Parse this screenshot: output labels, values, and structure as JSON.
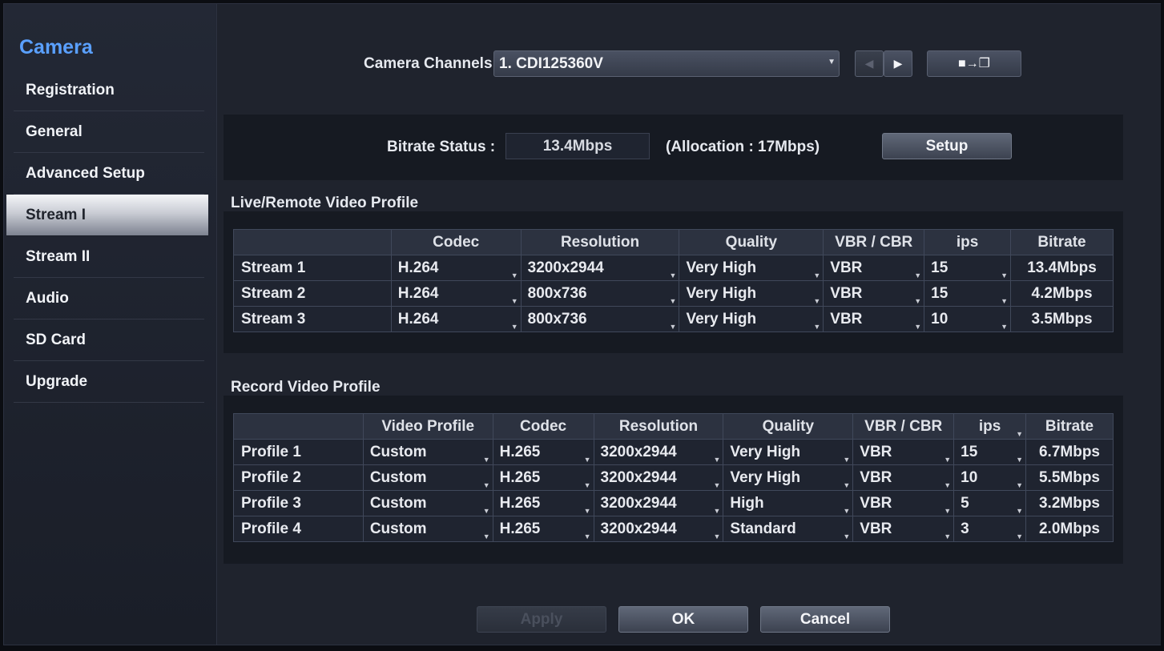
{
  "sidebar": {
    "title": "Camera",
    "items": [
      {
        "label": "Registration"
      },
      {
        "label": "General"
      },
      {
        "label": "Advanced Setup"
      },
      {
        "label": "Stream I"
      },
      {
        "label": "Stream II"
      },
      {
        "label": "Audio"
      },
      {
        "label": "SD Card"
      },
      {
        "label": "Upgrade"
      }
    ]
  },
  "camera": {
    "label": "Camera Channels :",
    "selected": "1. CDI125360V"
  },
  "bitrate": {
    "label": "Bitrate Status :",
    "value": "13.4Mbps",
    "allocation": "(Allocation : 17Mbps)",
    "setup_label": "Setup"
  },
  "live": {
    "title": "Live/Remote Video Profile",
    "headers": [
      "",
      "Codec",
      "Resolution",
      "Quality",
      "VBR / CBR",
      "ips",
      "Bitrate"
    ],
    "rows": [
      [
        "Stream 1",
        "H.264",
        "3200x2944",
        "Very High",
        "VBR",
        "15",
        "13.4Mbps"
      ],
      [
        "Stream 2",
        "H.264",
        "800x736",
        "Very High",
        "VBR",
        "15",
        "4.2Mbps"
      ],
      [
        "Stream 3",
        "H.264",
        "800x736",
        "Very High",
        "VBR",
        "10",
        "3.5Mbps"
      ]
    ]
  },
  "record": {
    "title": "Record Video Profile",
    "headers": [
      "",
      "Video Profile",
      "Codec",
      "Resolution",
      "Quality",
      "VBR / CBR",
      "ips",
      "Bitrate"
    ],
    "rows": [
      [
        "Profile 1",
        "Custom",
        "H.265",
        "3200x2944",
        "Very High",
        "VBR",
        "15",
        "6.7Mbps"
      ],
      [
        "Profile 2",
        "Custom",
        "H.265",
        "3200x2944",
        "Very High",
        "VBR",
        "10",
        "5.5Mbps"
      ],
      [
        "Profile 3",
        "Custom",
        "H.265",
        "3200x2944",
        "High",
        "VBR",
        "5",
        "3.2Mbps"
      ],
      [
        "Profile 4",
        "Custom",
        "H.265",
        "3200x2944",
        "Standard",
        "VBR",
        "3",
        "2.0Mbps"
      ]
    ]
  },
  "footer": {
    "apply": "Apply",
    "ok": "OK",
    "cancel": "Cancel"
  }
}
